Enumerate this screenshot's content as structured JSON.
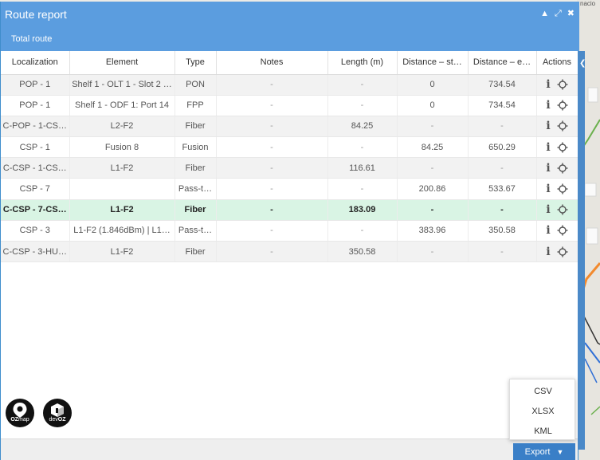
{
  "panel": {
    "title": "Route report",
    "tab": "Total route"
  },
  "map": {
    "corner_text": "nacio"
  },
  "table": {
    "headers": [
      "Localization",
      "Element",
      "Type",
      "Notes",
      "Length (m)",
      "Distance – st…",
      "Distance – e…",
      "Actions"
    ],
    "rows": [
      [
        "POP - 1",
        "Shelf 1 - OLT 1 - Slot 2 …",
        "PON",
        "-",
        "-",
        "0",
        "734.54"
      ],
      [
        "POP - 1",
        "Shelf 1 - ODF 1: Port 14",
        "FPP",
        "-",
        "-",
        "0",
        "734.54"
      ],
      [
        "C-POP - 1-CS…",
        "L2-F2",
        "Fiber",
        "-",
        "84.25",
        "-",
        "-"
      ],
      [
        "CSP - 1",
        "Fusion 8",
        "Fusion",
        "-",
        "-",
        "84.25",
        "650.29"
      ],
      [
        "C-CSP - 1-CS…",
        "L1-F2",
        "Fiber",
        "-",
        "116.61",
        "-",
        "-"
      ],
      [
        "CSP - 7",
        "",
        "Pass-t…",
        "-",
        "-",
        "200.86",
        "533.67"
      ],
      [
        "C-CSP - 7-CS…",
        "L1-F2",
        "Fiber",
        "-",
        "183.09",
        "-",
        "-"
      ],
      [
        "CSP - 3",
        "L1-F2 (1.846dBm) | L1…",
        "Pass-t…",
        "-",
        "-",
        "383.96",
        "350.58"
      ],
      [
        "C-CSP - 3-HU…",
        "L1-F2",
        "Fiber",
        "-",
        "350.58",
        "-",
        "-"
      ]
    ],
    "highlighted_row": 6,
    "action_icons": [
      "info-icon",
      "locate-icon"
    ]
  },
  "logos": {
    "ozmap_prefix": "OZ",
    "ozmap_suffix": "map",
    "devoz_prefix": "dev",
    "devoz_suffix": "OZ"
  },
  "export": {
    "button_label": "Export",
    "options": [
      "CSV",
      "XLSX",
      "KML"
    ]
  },
  "colors": {
    "header": "#5b9ddf",
    "highlight_row": "#d9f4e4",
    "export_button": "#3a7fc7"
  }
}
